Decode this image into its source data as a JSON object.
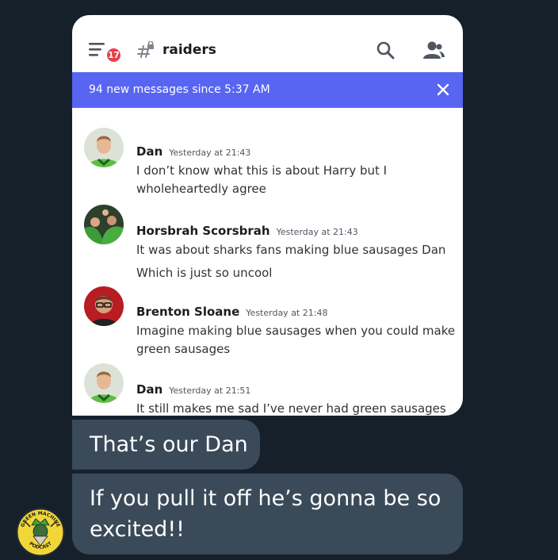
{
  "header": {
    "unread_count": "17",
    "channel_name": "raiders"
  },
  "banner": {
    "text": "94 new messages since 5:37 AM"
  },
  "messages": [
    {
      "author": "Dan",
      "timestamp": "Yesterday at 21:43",
      "lines": [
        "I don’t know what this is about Harry but I",
        "wholeheartedly agree"
      ]
    },
    {
      "author": "Horsbrah Scorsbrah",
      "timestamp": "Yesterday at 21:43",
      "lines": [
        "It was about sharks fans making blue sausages Dan",
        "Which is just so uncool"
      ]
    },
    {
      "author": "Brenton Sloane",
      "timestamp": "Yesterday at 21:48",
      "lines": [
        "Imagine making blue sausages when you could make",
        "green sausages"
      ]
    },
    {
      "author": "Dan",
      "timestamp": "Yesterday at 21:51",
      "lines": [
        "It still makes me sad I’ve never had green sausages"
      ]
    }
  ],
  "chat": {
    "bubbles": [
      {
        "lines": [
          "That’s our Dan"
        ]
      },
      {
        "lines": [
          "If you pull it off he’s gonna be so",
          "excited!!"
        ]
      }
    ]
  },
  "logo": {
    "top_text": "GREEN MACHINE",
    "bottom_text": "PODCAST"
  },
  "colors": {
    "page_background": "#15202b",
    "banner": "#5865f2",
    "badge": "#e8404a",
    "bubble": "#3a4a58"
  }
}
